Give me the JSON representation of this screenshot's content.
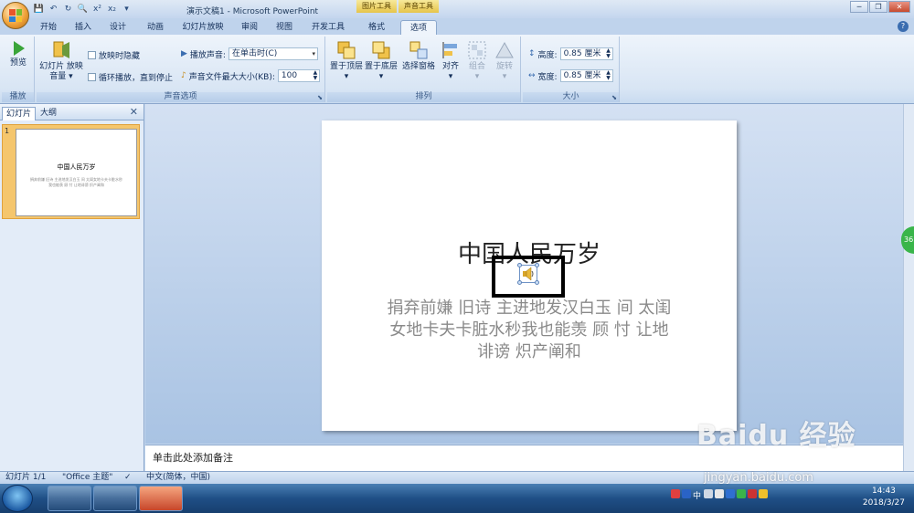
{
  "window": {
    "title": "演示文稿1 - Microsoft PowerPoint",
    "context_tab_picture": "图片工具",
    "context_tab_sound": "声音工具"
  },
  "tabs": [
    "开始",
    "插入",
    "设计",
    "动画",
    "幻灯片放映",
    "审阅",
    "视图",
    "开发工具",
    "格式",
    "选项"
  ],
  "active_tab": "选项",
  "ribbon": {
    "play": {
      "preview_label": "预览",
      "group_label": "播放"
    },
    "sound_options": {
      "slideshow_volume_label": "幻灯片 放映音量",
      "hide_during_show_label": "放映时隐藏",
      "loop_label": "循环播放，直到停止",
      "play_sound_label": "播放声音:",
      "play_sound_value": "在单击时(C)",
      "max_size_label": "声音文件最大大小(KB):",
      "max_size_value": "100",
      "group_label": "声音选项"
    },
    "arrange": {
      "bring_front": "置于顶层",
      "send_back": "置于底层",
      "selection_pane": "选择窗格",
      "align": "对齐",
      "group": "组合",
      "rotate": "旋转",
      "group_label": "排列"
    },
    "size": {
      "height_label": "高度:",
      "height_value": "0.85 厘米",
      "width_label": "宽度:",
      "width_value": "0.85 厘米",
      "group_label": "大小"
    }
  },
  "left_panel": {
    "tab_slides": "幻灯片",
    "tab_outline": "大纲",
    "close": "✕",
    "thumb_number": "1",
    "thumb_title": "中国人民万岁",
    "thumb_body": "捐弃前嫌 旧诗 主进地发汉白玉 间 太闺女地卡夫卡脏水秒我也能羡 顾 忖 让地诽谤 炽产阐和"
  },
  "slide": {
    "title": "中国人民万岁",
    "body": "捐弃前嫌 旧诗 主进地发汉白玉 间 太闺女地卡夫卡脏水秒我也能羡 顾 忖 让地诽谤 炽产阐和"
  },
  "notes": {
    "placeholder": "单击此处添加备注"
  },
  "statusbar": {
    "slide_info": "幻灯片 1/1",
    "theme": "\"Office 主题\"",
    "language": "中文(简体，中国)"
  },
  "side_badge": "36",
  "taskbar": {
    "time": "14:43",
    "date": "2018/3/27",
    "ime": "中"
  },
  "watermark": {
    "text": "Baidu 经验",
    "url": "jingyan.baidu.com"
  }
}
